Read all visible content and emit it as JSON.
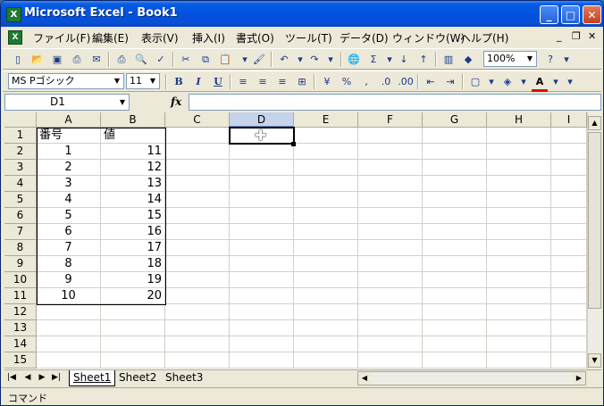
{
  "window": {
    "title": "Microsoft Excel - Book1",
    "app_icon": "excel-icon"
  },
  "menu": {
    "items": [
      "ファイル(F)",
      "編集(E)",
      "表示(V)",
      "挿入(I)",
      "書式(O)",
      "ツール(T)",
      "データ(D)",
      "ウィンドウ(W)",
      "ヘルプ(H)"
    ],
    "doc_controls": [
      "_",
      "❐",
      "✕"
    ]
  },
  "toolbar": {
    "zoom": "100%"
  },
  "formatting": {
    "font_name": "MS Pゴシック",
    "font_size": "11"
  },
  "formula_bar": {
    "name_box": "D1",
    "fx": "fx",
    "formula": ""
  },
  "columns": [
    "A",
    "B",
    "C",
    "D",
    "E",
    "F",
    "G",
    "H",
    "I"
  ],
  "active_column": "D",
  "rows": [
    "1",
    "2",
    "3",
    "4",
    "5",
    "6",
    "7",
    "8",
    "9",
    "10",
    "11",
    "12",
    "13",
    "14",
    "15"
  ],
  "table": {
    "headers": [
      "番号",
      "値"
    ],
    "data": [
      [
        "1",
        "11"
      ],
      [
        "2",
        "12"
      ],
      [
        "3",
        "13"
      ],
      [
        "4",
        "14"
      ],
      [
        "5",
        "15"
      ],
      [
        "6",
        "16"
      ],
      [
        "7",
        "17"
      ],
      [
        "8",
        "18"
      ],
      [
        "9",
        "19"
      ],
      [
        "10",
        "20"
      ]
    ]
  },
  "sheets": [
    "Sheet1",
    "Sheet2",
    "Sheet3"
  ],
  "active_sheet": "Sheet1",
  "status": "コマンド",
  "colors": {
    "title_bar": "#0052e0",
    "active_header": "#c5d3eb",
    "grid_line": "#d4d0c8"
  }
}
